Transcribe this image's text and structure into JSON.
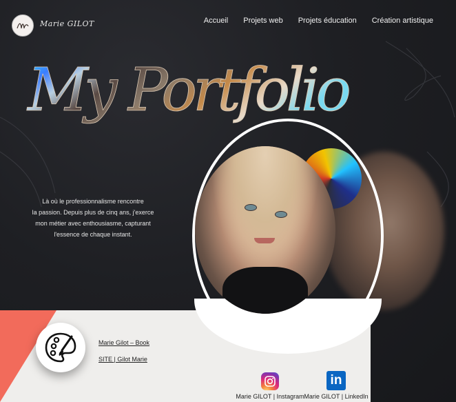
{
  "header": {
    "logo_initials": "MG",
    "logo_name": "Marie GILOT",
    "nav": [
      {
        "label": "Accueil"
      },
      {
        "label": "Projets web"
      },
      {
        "label": "Projets éducation"
      },
      {
        "label": "Création artistique"
      }
    ]
  },
  "hero": {
    "title": "My Portfolio"
  },
  "intro": {
    "line1": "Là où le professionnalisme rencontre",
    "line2": "la passion. Depuis plus de cinq ans, j'exerce",
    "line3": "mon métier avec enthousiasme, capturant",
    "line4": "l'essence de chaque instant."
  },
  "card": {
    "link1": "Marie Gilot – Book",
    "link2": "SITE | Gilot Marie",
    "palette_icon": "palette-icon"
  },
  "social": {
    "instagram_label": "Marie GILOT | Instagram",
    "linkedin_label": "Marie GILOT | LinkedIn",
    "linkedin_glyph": "in"
  },
  "colors": {
    "background": "#1e1f23",
    "card": "#efeeec",
    "accent_triangle": "#f26b5b",
    "linkedin": "#0a66c2"
  }
}
